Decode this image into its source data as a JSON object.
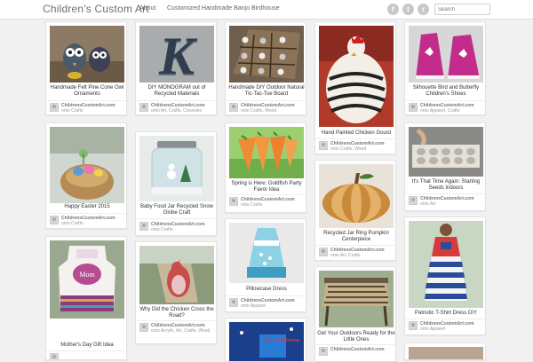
{
  "header": {
    "brand": "Children's Custom Art",
    "nav": {
      "about": "About",
      "banjo": "Customized Handmade Banjo Birdhouse"
    },
    "social": {
      "facebook": "f",
      "twitter": "t",
      "rss": "r"
    },
    "search_placeholder": "Search"
  },
  "pins": [
    {
      "title": "Handmade Felt Pine Cone Owl Ornaments",
      "user": "ChildrensCustomArt.com",
      "cats": "onto Crafts"
    },
    {
      "title": "Happy Easter 2015",
      "user": "ChildrensCustomArt.com",
      "cats": "onto Crafts"
    },
    {
      "title": "Mother's Day Gift Idea",
      "user": "ChildrensCustomArt.com",
      "cats": ""
    },
    {
      "title": "DIY MONOGRAM out of Recycled Materials",
      "user": "ChildrensCustomArt.com",
      "cats": "onto Art, Crafts, Consoles"
    },
    {
      "title": "Baby Food Jar Recycled Snow Globe Craft",
      "user": "ChildrensCustomArt.com",
      "cats": "onto Crafts"
    },
    {
      "title": "Why Did the Chicken Cross the Road?",
      "user": "ChildrensCustomArt.com",
      "cats": "onto Acrylic, Art, Crafts, Wood"
    },
    {
      "title": "Handmade DIY Outdoor Natural Tic-Tac-Toe Board",
      "user": "ChildrensCustomArt.com",
      "cats": "onto Crafts, Wood"
    },
    {
      "title": "Spring is Here: Goldfish Party Favor Idea",
      "user": "ChildrensCustomArt.com",
      "cats": "onto Crafts"
    },
    {
      "title": "Pillowcase Dress",
      "user": "ChildrensCustomArt.com",
      "cats": "onto Apparel"
    },
    {
      "title": "Hand Painted Chicken Gourd",
      "user": "ChildrensCustomArt.com",
      "cats": "onto Crafts, Wood"
    },
    {
      "title": "Recycled Jar Ring Pumpkin Centerpiece",
      "user": "ChildrensCustomArt.com",
      "cats": "onto Art, Crafts"
    },
    {
      "title": "Get Your Outdoors Ready for the Little Ones",
      "user": "ChildrensCustomArt.com",
      "cats": ""
    },
    {
      "title": "Silhouette Bird and Butterfly Children's Shoes",
      "user": "ChildrensCustomArt.com",
      "cats": "onto Apparel, Crafts"
    },
    {
      "title": "It's That Time Again: Starting Seeds Indoors",
      "user": "ChildrensCustomArt.com",
      "cats": "onto Art"
    },
    {
      "title": "Patriotic T-Shirt Dress DIY",
      "user": "ChildrensCustomArt.com",
      "cats": "onto Apparel"
    }
  ],
  "christmas_text": "Merry Christmas",
  "colors": {
    "background": "#f1f1f1",
    "card": "#ffffff",
    "brand_text": "#6f6f6f"
  }
}
